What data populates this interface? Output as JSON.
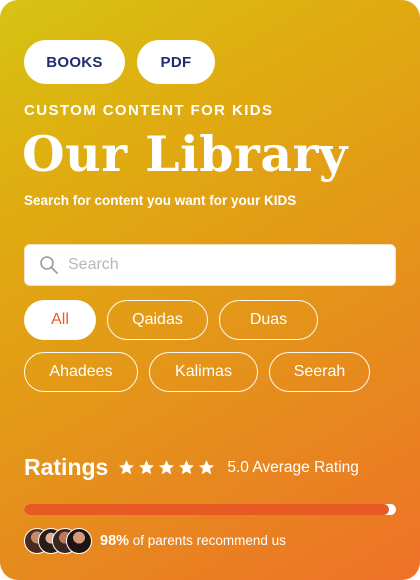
{
  "top_buttons": {
    "books_label": "BOOKS",
    "pdf_label": "PDF"
  },
  "header": {
    "eyebrow": "CUSTOM CONTENT FOR KIDS",
    "title": "Our Library",
    "subtitle": "Search for content you want for your KIDS"
  },
  "search": {
    "placeholder": "Search",
    "value": ""
  },
  "filters": {
    "active": "All",
    "row1": [
      "All",
      "Qaidas",
      "Duas"
    ],
    "row2": [
      "Ahadees",
      "Kalimas",
      "Seerah"
    ]
  },
  "ratings": {
    "title": "Ratings",
    "stars": 5,
    "text": "5.0 Average Rating"
  },
  "recommend": {
    "percent_fraction": 0.98,
    "percent_label": "98%",
    "text": " of parents recommend us",
    "avatar_count": 4
  },
  "colors": {
    "accent": "#e85a24",
    "navy": "#1f2d6e",
    "white": "#ffffff"
  }
}
